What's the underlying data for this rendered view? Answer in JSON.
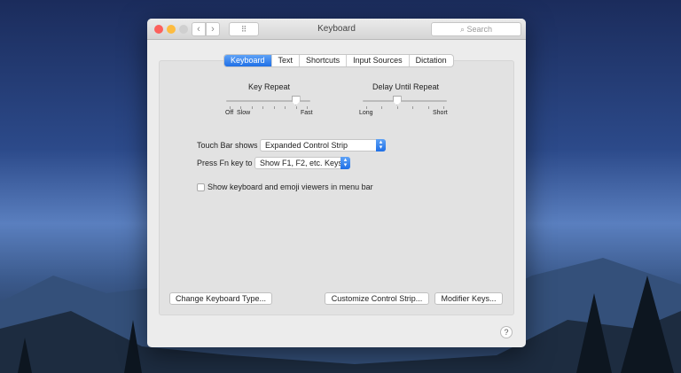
{
  "window": {
    "title": "Keyboard",
    "search_placeholder": "Search",
    "back": "‹",
    "forward": "›",
    "grid": "⠿"
  },
  "tabs": [
    {
      "label": "Keyboard",
      "active": true
    },
    {
      "label": "Text"
    },
    {
      "label": "Shortcuts"
    },
    {
      "label": "Input Sources"
    },
    {
      "label": "Dictation"
    }
  ],
  "key_repeat": {
    "label": "Key Repeat",
    "min_labels": [
      "Off",
      "Slow"
    ],
    "max_label": "Fast",
    "ticks": 8,
    "value_index": 6
  },
  "delay_until_repeat": {
    "label": "Delay Until Repeat",
    "min_label": "Long",
    "max_label": "Short",
    "ticks": 6,
    "value_index": 2
  },
  "touch_bar": {
    "label": "Touch Bar shows",
    "value": "Expanded Control Strip"
  },
  "fn_key": {
    "label": "Press Fn key to",
    "value": "Show F1, F2, etc. Keys"
  },
  "viewers_checkbox": {
    "label": "Show keyboard and emoji viewers in menu bar",
    "checked": false
  },
  "buttons": {
    "change_type": "Change Keyboard Type...",
    "customize": "Customize Control Strip...",
    "modifier": "Modifier Keys..."
  },
  "help": "?",
  "colors": {
    "accent": "#2a78ea",
    "close": "#fc605c",
    "minimize": "#fdbc40"
  }
}
